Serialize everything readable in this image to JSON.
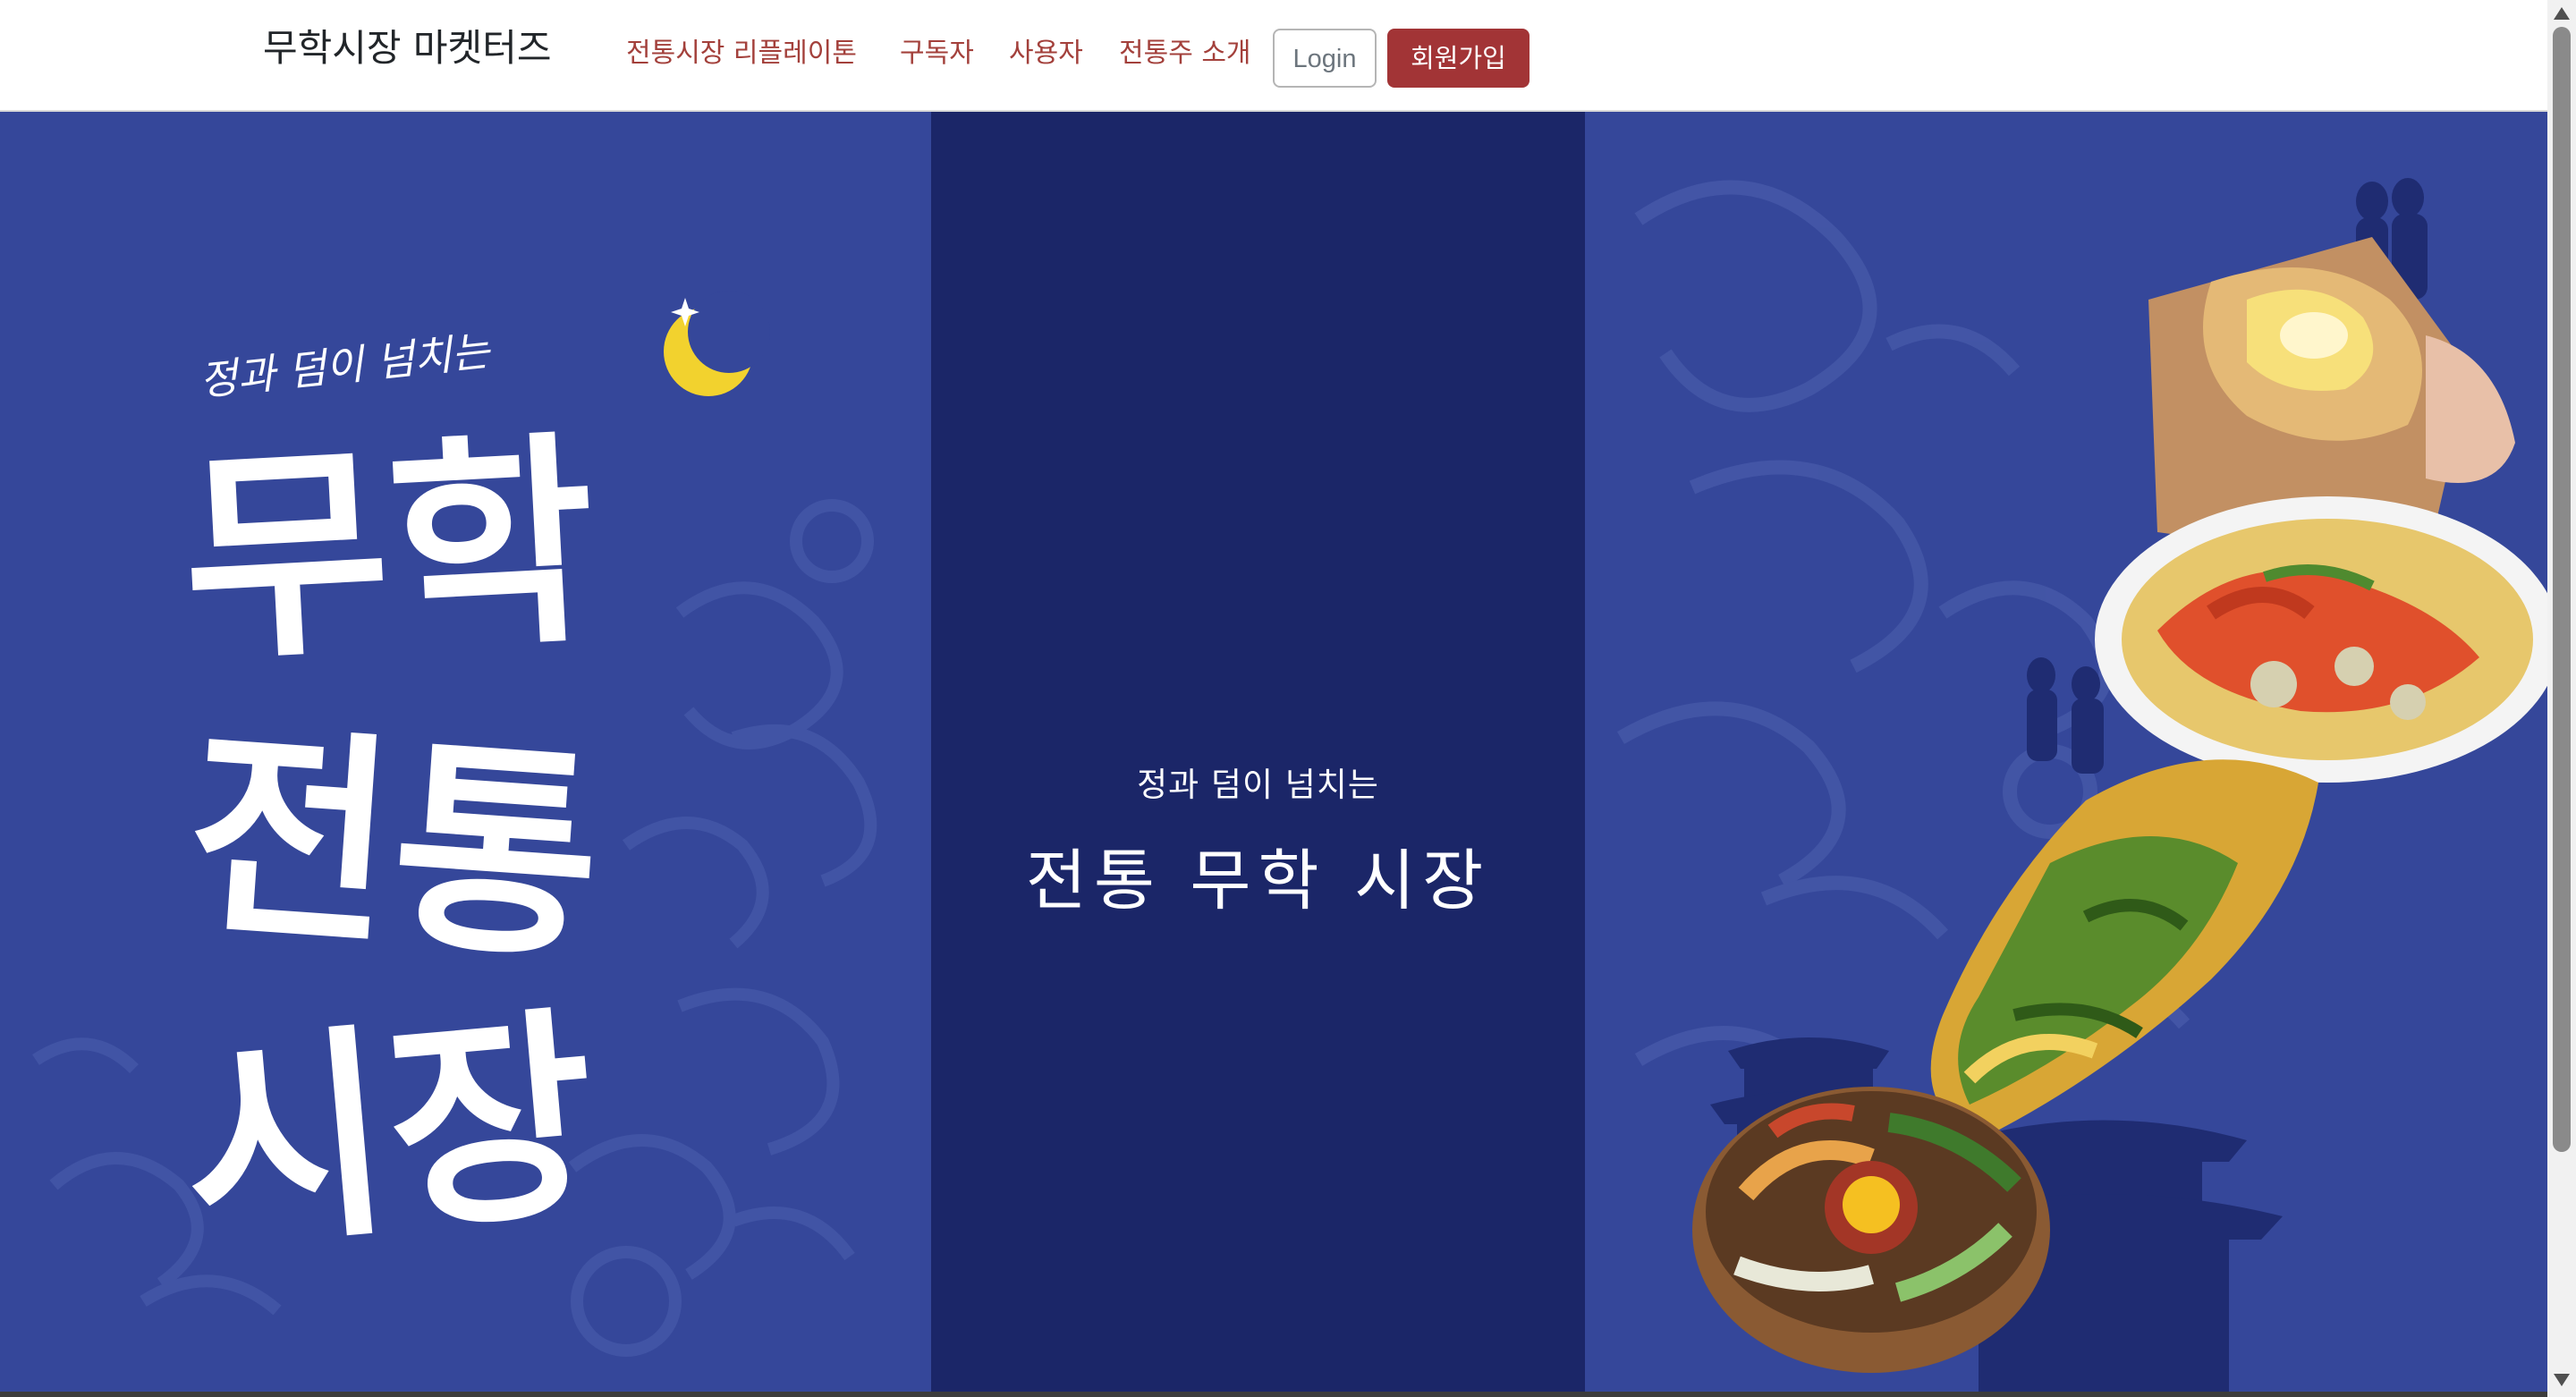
{
  "navbar": {
    "brand": "무학시장 마켓터즈",
    "links": [
      "전통시장 리플레이톤",
      "구독자",
      "사용자",
      "전통주 소개"
    ],
    "login_label": "Login",
    "signup_label": "회원가입"
  },
  "hero": {
    "left_poster": {
      "tagline": "정과 덤이 넘치는",
      "calligraphy_lines": [
        "무학",
        "전통",
        "시장"
      ]
    },
    "center": {
      "subtitle": "정과 덤이 넘치는",
      "title": "전통 무학 시장"
    }
  },
  "colors": {
    "panel_blue": "#35479a",
    "center_navy": "#1b2668",
    "accent_red": "#a23436",
    "link_red": "#a3403b",
    "moon_yellow": "#f2d22e"
  }
}
